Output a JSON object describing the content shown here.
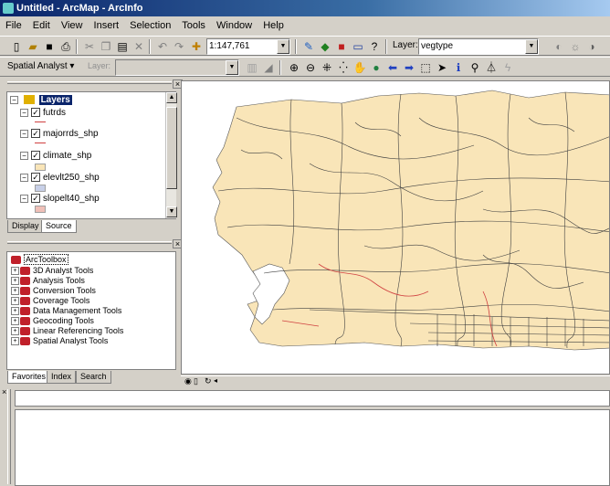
{
  "window": {
    "title": "Untitled - ArcMap - ArcInfo"
  },
  "menu": [
    "File",
    "Edit",
    "View",
    "Insert",
    "Selection",
    "Tools",
    "Window",
    "Help"
  ],
  "toolbar": {
    "scale_value": "1:147,761",
    "layer_label": "Layer:",
    "layer_value": "vegtype"
  },
  "spatial_toolbar": {
    "spatial_analyst_label": "Spatial Analyst ▾",
    "layer_label": "Layer:"
  },
  "toc": {
    "root_label": "Layers",
    "layers": [
      {
        "name": "futrds",
        "symbol": "line",
        "color": "#d04040"
      },
      {
        "name": "majorrds_shp",
        "symbol": "line",
        "color": "#d04040"
      },
      {
        "name": "climate_shp",
        "symbol": "fill",
        "color": "#f9e5b8"
      },
      {
        "name": "elevlt250_shp",
        "symbol": "fill",
        "color": "#c8d0e8"
      },
      {
        "name": "slopelt40_shp",
        "symbol": "fill",
        "color": "#f0c0b8"
      }
    ],
    "tabs": [
      "Display",
      "Source"
    ]
  },
  "toolbox": {
    "root_label": "ArcToolbox",
    "items": [
      "3D Analyst Tools",
      "Analysis Tools",
      "Conversion Tools",
      "Coverage Tools",
      "Data Management Tools",
      "Geocoding Tools",
      "Linear Referencing Tools",
      "Spatial Analyst Tools"
    ],
    "tabs": [
      "Favorites",
      "Index",
      "Search"
    ]
  },
  "colors": {
    "land": "#f9e5b8",
    "road": "#404040",
    "water": "#ffffff",
    "accent_road": "#d04040"
  }
}
